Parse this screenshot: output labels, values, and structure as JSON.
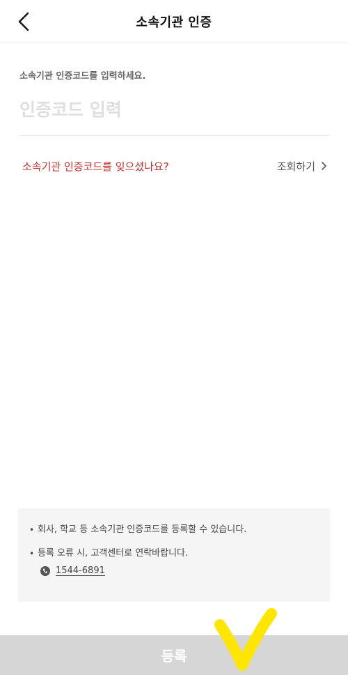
{
  "header": {
    "title": "소속기관 인증",
    "back_icon": "chevron-left-icon"
  },
  "code_entry": {
    "label": "소속기관 인증코드를 입력하세요.",
    "placeholder": "인증코드 입력",
    "value": ""
  },
  "forgot": {
    "text": "소속기관 인증코드를 잊으셨나요?",
    "link_label": "조회하기",
    "link_icon": "chevron-right-icon",
    "text_color": "#c0312e"
  },
  "info": {
    "items": [
      "회사, 학교 등 소속기관 인증코드를 등록할 수 있습니다.",
      "등록 오류 시, 고객센터로 연락바랍니다."
    ],
    "phone_icon": "phone-icon",
    "phone": "1544-6891"
  },
  "register_button": {
    "label": "등록",
    "enabled": false,
    "background": "#d6d6d6"
  },
  "annotation": {
    "icon": "check-mark-icon",
    "color": "#ffe600"
  }
}
